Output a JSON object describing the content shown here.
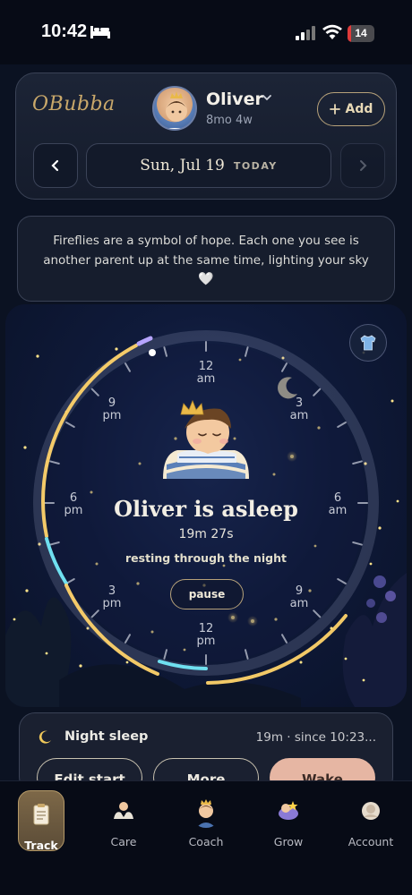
{
  "status_bar": {
    "time": "10:42",
    "battery": "14",
    "battery_level": 0.14
  },
  "header": {
    "logo": "OBubba",
    "child_name": "Oliver",
    "child_age": "8mo 4w",
    "add_label": "Add",
    "date": "Sun, Jul 19",
    "today": "TODAY"
  },
  "quote": {
    "text": "Fireflies are a symbol of hope. Each one you see is another parent up at the same time, lighting your sky",
    "heart": "🤍"
  },
  "dial": {
    "labels": [
      {
        "hour": "12",
        "ampm": "am"
      },
      {
        "hour": "3",
        "ampm": "am"
      },
      {
        "hour": "6",
        "ampm": "am"
      },
      {
        "hour": "9",
        "ampm": "am"
      },
      {
        "hour": "12",
        "ampm": "pm"
      },
      {
        "hour": "3",
        "ampm": "pm"
      },
      {
        "hour": "6",
        "ampm": "pm"
      },
      {
        "hour": "9",
        "ampm": "pm"
      }
    ],
    "title": "Oliver is asleep",
    "duration": "19m 27s",
    "subtitle": "resting through the night",
    "pause_label": "pause"
  },
  "night_card": {
    "label": "Night sleep",
    "meta": "19m · since 10:23...",
    "edit_label": "Edit start",
    "more_label": "More",
    "wake_label": "Wake"
  },
  "tabs": [
    {
      "label": "Track",
      "icon": "clipboard-icon"
    },
    {
      "label": "Care",
      "icon": "hands-icon"
    },
    {
      "label": "Coach",
      "icon": "baby-coach-icon"
    },
    {
      "label": "Grow",
      "icon": "grow-icon"
    },
    {
      "label": "Account",
      "icon": "account-icon"
    }
  ],
  "colors": {
    "accent_gold": "#c9a86a",
    "wake": "#e6b6a3",
    "background": "#0b1222"
  }
}
